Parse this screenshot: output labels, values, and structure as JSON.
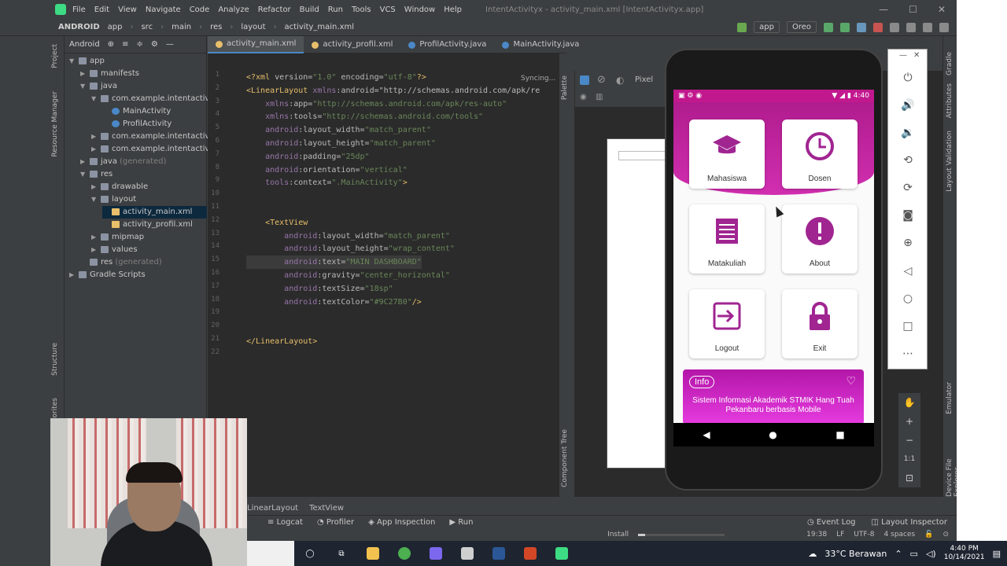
{
  "window": {
    "title": "IntentActivityx - activity_main.xml [IntentActivityx.app]"
  },
  "menu": [
    "File",
    "Edit",
    "View",
    "Navigate",
    "Code",
    "Analyze",
    "Refactor",
    "Build",
    "Run",
    "Tools",
    "VCS",
    "Window",
    "Help"
  ],
  "breadcrumb_top": [
    "ANDROID",
    "app",
    "src",
    "main",
    "res",
    "layout",
    "activity_main.xml"
  ],
  "toolbar": {
    "config": "app",
    "device": "Oreo"
  },
  "project": {
    "view": "Android",
    "items": [
      {
        "label": "app",
        "depth": 0,
        "open": true
      },
      {
        "label": "manifests",
        "depth": 1,
        "open": false
      },
      {
        "label": "java",
        "depth": 1,
        "open": true
      },
      {
        "label": "com.example.intentactivityx",
        "depth": 2,
        "open": true
      },
      {
        "label": "MainActivity",
        "depth": 3,
        "file": true
      },
      {
        "label": "ProfilActivity",
        "depth": 3,
        "file": true
      },
      {
        "label": "com.example.intentactivityx",
        "depth": 2,
        "open": false
      },
      {
        "label": "com.example.intentactivityx",
        "depth": 2,
        "open": false
      },
      {
        "label": "java",
        "suffix": "(generated)",
        "depth": 1,
        "open": false
      },
      {
        "label": "res",
        "depth": 1,
        "open": true
      },
      {
        "label": "drawable",
        "depth": 2,
        "open": false
      },
      {
        "label": "layout",
        "depth": 2,
        "open": true
      },
      {
        "label": "activity_main.xml",
        "depth": 3,
        "file": true,
        "selected": true
      },
      {
        "label": "activity_profil.xml",
        "depth": 3,
        "file": true
      },
      {
        "label": "mipmap",
        "depth": 2,
        "open": false
      },
      {
        "label": "values",
        "depth": 2,
        "open": false
      },
      {
        "label": "res",
        "suffix": "(generated)",
        "depth": 1
      },
      {
        "label": "Gradle Scripts",
        "depth": 0,
        "open": false
      }
    ]
  },
  "left_tool_windows": [
    "Project",
    "Resource Manager",
    "Structure",
    "Favorites"
  ],
  "tabs": [
    "activity_main.xml",
    "activity_profil.xml",
    "ProfilActivity.java",
    "MainActivity.java"
  ],
  "editor": {
    "status": "Syncing...",
    "lines": [
      {
        "n": "1",
        "t": "<?xml version=\"1.0\" encoding=\"utf-8\"?>"
      },
      {
        "n": "2",
        "t": "<LinearLayout xmlns:android=\"http://schemas.android.com/apk/re"
      },
      {
        "n": "3",
        "t": "    xmlns:app=\"http://schemas.android.com/apk/res-auto\""
      },
      {
        "n": "4",
        "t": "    xmlns:tools=\"http://schemas.android.com/tools\""
      },
      {
        "n": "5",
        "t": "    android:layout_width=\"match_parent\""
      },
      {
        "n": "6",
        "t": "    android:layout_height=\"match_parent\""
      },
      {
        "n": "7",
        "t": "    android:padding=\"25dp\""
      },
      {
        "n": "8",
        "t": "    android:orientation=\"vertical\""
      },
      {
        "n": "9",
        "t": "    tools:context=\".MainActivity\">"
      },
      {
        "n": "10",
        "t": ""
      },
      {
        "n": "11",
        "t": ""
      },
      {
        "n": "12",
        "t": "    <TextView"
      },
      {
        "n": "13",
        "t": "        android:layout_width=\"match_parent\""
      },
      {
        "n": "14",
        "t": "        android:layout_height=\"wrap_content\""
      },
      {
        "n": "15",
        "t": "        android:text=\"MAIN DASHBOARD\""
      },
      {
        "n": "16",
        "t": "        android:gravity=\"center_horizontal\""
      },
      {
        "n": "17",
        "t": "        android:textSize=\"18sp\""
      },
      {
        "n": "18",
        "t": "        android:textColor=\"#9C27B0\"/>"
      },
      {
        "n": "19",
        "t": ""
      },
      {
        "n": "20",
        "t": ""
      },
      {
        "n": "21",
        "t": "</LinearLayout>"
      },
      {
        "n": "22",
        "t": ""
      }
    ]
  },
  "editor_crumbs": [
    "LinearLayout",
    "TextView"
  ],
  "design": {
    "device": "Pixel",
    "palette": "Palette",
    "component_tree": "Component Tree"
  },
  "right_tool_windows": [
    "Gradle",
    "Attributes",
    "Layout Validation",
    "Emulator",
    "Device File Explorer"
  ],
  "phone": {
    "time": "4:40",
    "menu": [
      {
        "label": "Mahasiswa",
        "icon": "graduation-cap-icon"
      },
      {
        "label": "Dosen",
        "icon": "clock-icon"
      },
      {
        "label": "Matakuliah",
        "icon": "list-icon"
      },
      {
        "label": "About",
        "icon": "alert-icon"
      },
      {
        "label": "Logout",
        "icon": "logout-icon"
      },
      {
        "label": "Exit",
        "icon": "lock-icon"
      }
    ],
    "info": {
      "tag": "Info",
      "text": "Sistem Informasi Akademik STMIK Hang Tuah Pekanbaru berbasis Mobile"
    }
  },
  "emulator_zoom": "1:1",
  "bottom_tools": {
    "left": [
      "Logcat",
      "Profiler",
      "App Inspection",
      "Run"
    ],
    "right": [
      "Event Log",
      "Layout Inspector"
    ]
  },
  "statusbar": {
    "task": "Install",
    "pos": "19:38",
    "eol": "LF",
    "enc": "UTF-8",
    "indent": "4 spaces"
  },
  "taskbar": {
    "weather": "33°C Berawan",
    "time": "4:40 PM",
    "date": "10/14/2021"
  },
  "colors": {
    "accent": "#9C27B0",
    "header": "#c2188e",
    "ide_bg": "#2b2b2b"
  }
}
